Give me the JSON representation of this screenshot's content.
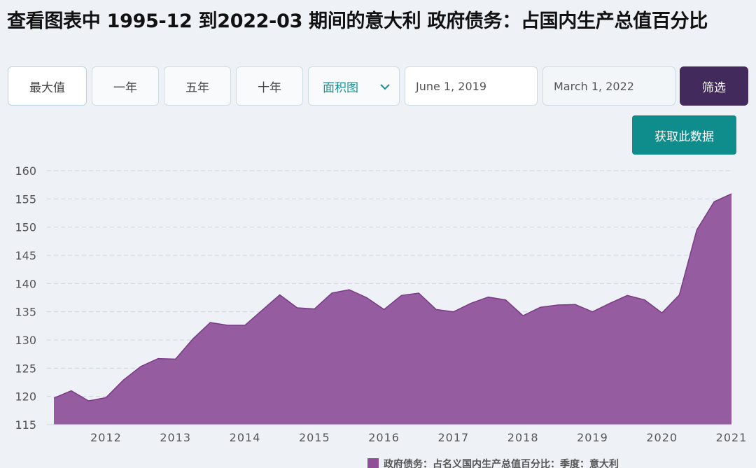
{
  "page": {
    "title": "查看图表中 1995-12 到2022-03 期间的意大利 政府债务：占国内生产总值百分比"
  },
  "controls": {
    "range_buttons": [
      "最大值",
      "一年",
      "五年",
      "十年"
    ],
    "chart_type_select": "面积图",
    "start_date": "June 1, 2019",
    "end_date": "March 1, 2022",
    "filter_label": "筛选",
    "get_data_label": "获取此数据"
  },
  "colors": {
    "area_fill": "#8e4f98",
    "area_stroke": "#7a3a86",
    "filter_button": "#432a5c",
    "get_data_button": "#0f8c8c",
    "select_text": "#1a8f91"
  },
  "chart_data": {
    "type": "area",
    "x": [
      "2011-04",
      "2011-07",
      "2011-10",
      "2012-01",
      "2012-04",
      "2012-07",
      "2012-10",
      "2013-01",
      "2013-04",
      "2013-07",
      "2013-10",
      "2014-01",
      "2014-04",
      "2014-07",
      "2014-10",
      "2015-01",
      "2015-04",
      "2015-07",
      "2015-10",
      "2016-01",
      "2016-04",
      "2016-07",
      "2016-10",
      "2017-01",
      "2017-04",
      "2017-07",
      "2017-10",
      "2018-01",
      "2018-04",
      "2018-07",
      "2018-10",
      "2019-01",
      "2019-04",
      "2019-07",
      "2019-10",
      "2020-01",
      "2020-04",
      "2020-07",
      "2020-10",
      "2021-01"
    ],
    "series": [
      {
        "name": "政府债务：占名义国内生产总值百分比：季度：意大利",
        "values": [
          119.7,
          121.0,
          119.2,
          119.8,
          122.9,
          125.3,
          126.7,
          126.6,
          130.2,
          133.1,
          132.6,
          132.6,
          135.3,
          138.0,
          135.7,
          135.5,
          138.3,
          138.9,
          137.5,
          135.4,
          137.9,
          138.3,
          135.4,
          135.0,
          136.5,
          137.6,
          137.1,
          134.3,
          135.8,
          136.2,
          136.3,
          135.0,
          136.5,
          137.9,
          137.1,
          134.8,
          138.0,
          149.5,
          154.5,
          155.9
        ]
      }
    ],
    "x_tick_labels": [
      "2012",
      "2013",
      "2014",
      "2015",
      "2016",
      "2017",
      "2018",
      "2019",
      "2020",
      "2021"
    ],
    "y_ticks": [
      115,
      120,
      125,
      130,
      135,
      140,
      145,
      150,
      155,
      160
    ],
    "ylim": [
      115,
      160
    ],
    "grid": true,
    "legend_position": "bottom"
  }
}
